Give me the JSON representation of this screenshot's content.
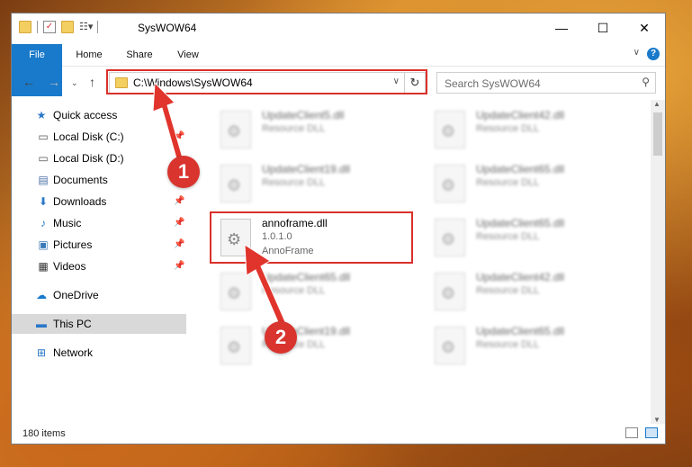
{
  "window": {
    "title": "SysWOW64",
    "minimize_icon": "minimize-icon",
    "maximize_icon": "maximize-icon",
    "close_icon": "close-icon"
  },
  "ribbon": {
    "tabs": [
      "File",
      "Home",
      "Share",
      "View"
    ],
    "help": "?"
  },
  "address": {
    "path": "C:\\Windows\\SysWOW64",
    "search_placeholder": "Search SysWOW64"
  },
  "sidebar": {
    "quick_access": "Quick access",
    "items": [
      {
        "label": "Local Disk (C:)",
        "icon": "drive-icon",
        "pinned": true
      },
      {
        "label": "Local Disk (D:)",
        "icon": "drive-icon",
        "pinned": false
      },
      {
        "label": "Documents",
        "icon": "documents-icon",
        "pinned": true
      },
      {
        "label": "Downloads",
        "icon": "download-icon",
        "pinned": true
      },
      {
        "label": "Music",
        "icon": "music-icon",
        "pinned": true
      },
      {
        "label": "Pictures",
        "icon": "pictures-icon",
        "pinned": true
      },
      {
        "label": "Videos",
        "icon": "videos-icon",
        "pinned": true
      }
    ],
    "onedrive": "OneDrive",
    "this_pc": "This PC",
    "network": "Network"
  },
  "files": [
    {
      "name": "UpdateClient5.dll",
      "desc": "Resource DLL",
      "blurred": true
    },
    {
      "name": "UpdateClient42.dll",
      "desc": "Resource DLL",
      "blurred": true
    },
    {
      "name": "UpdateClient19.dll",
      "desc": "Resource DLL",
      "blurred": true
    },
    {
      "name": "UpdateClient65.dll",
      "desc": "Resource DLL",
      "blurred": true
    },
    {
      "name": "annoframe.dll",
      "version": "1.0.1.0",
      "desc": "AnnoFrame",
      "blurred": false
    },
    {
      "name": "UpdateClient65.dll",
      "desc": "Resource DLL",
      "blurred": true
    },
    {
      "name": "UpdateClient65.dll",
      "desc": "Resource DLL",
      "blurred": true
    },
    {
      "name": "UpdateClient42.dll",
      "desc": "Resource DLL",
      "blurred": true
    },
    {
      "name": "UpdateClient19.dll",
      "desc": "Resource DLL",
      "blurred": true
    },
    {
      "name": "UpdateClient65.dll",
      "desc": "Resource DLL",
      "blurred": true
    }
  ],
  "status": {
    "count": "180 items"
  },
  "annotations": {
    "step1": "1",
    "step2": "2",
    "highlight_color": "#d9302a"
  }
}
